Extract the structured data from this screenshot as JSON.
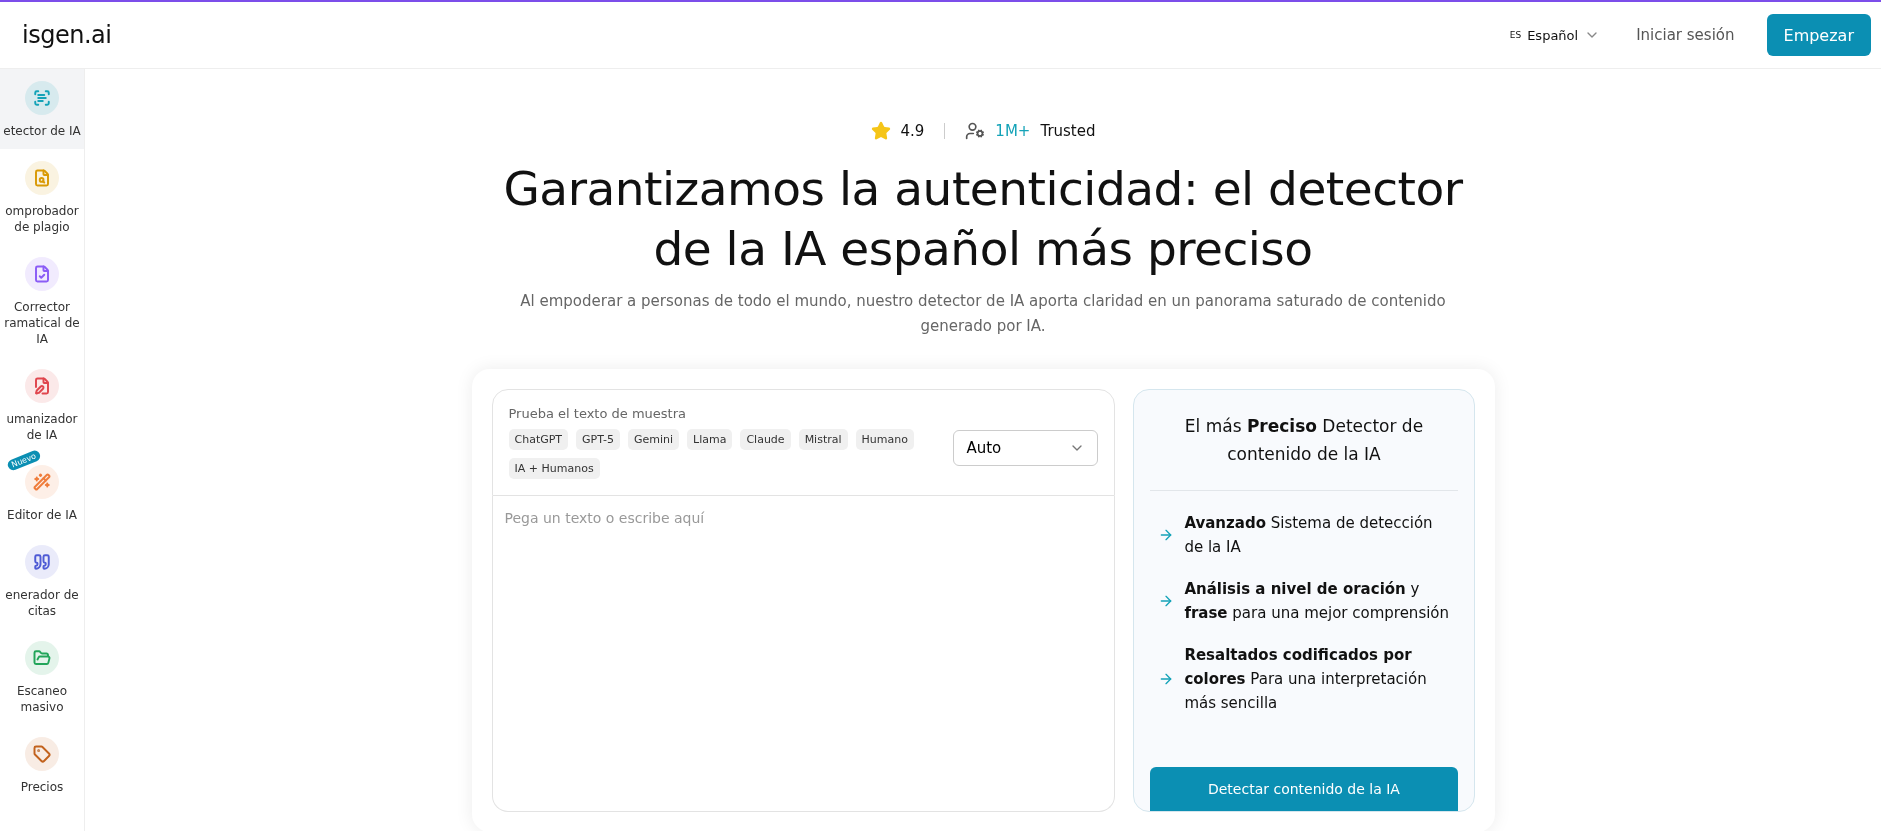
{
  "header": {
    "logo": "isgen.ai",
    "language": {
      "code": "ES",
      "label": "Español"
    },
    "login": "Iniciar sesión",
    "cta": "Empezar"
  },
  "sidebar": {
    "items": [
      {
        "label": "etector de IA",
        "selected": true,
        "color": "#14a3b8"
      },
      {
        "label": "omprobador\nde plagio",
        "selected": false,
        "color": "#d99a06"
      },
      {
        "label": "Corrector\nramatical de\nIA",
        "selected": false,
        "color": "#8b5cf6"
      },
      {
        "label": "umanizador\nde IA",
        "selected": false,
        "color": "#e0464e"
      },
      {
        "label": "Editor de IA",
        "selected": false,
        "color": "#ef7d3c",
        "badge": "Nuevo"
      },
      {
        "label": "enerador de\ncitas",
        "selected": false,
        "color": "#4f5bd5"
      },
      {
        "label": "Escaneo\nmasivo",
        "selected": false,
        "color": "#22a55a"
      },
      {
        "label": "Precios",
        "selected": false,
        "color": "#c2621d"
      }
    ]
  },
  "hero": {
    "rating": "4.9",
    "users": "1M+",
    "users_label": "Trusted",
    "title": "Garantizamos la autenticidad: el detector de la IA español más preciso",
    "subtitle": "Al empoderar a personas de todo el mundo, nuestro detector de IA aporta claridad en un panorama saturado de contenido generado por IA."
  },
  "editor": {
    "sample_label": "Prueba el texto de muestra",
    "samples": [
      "ChatGPT",
      "GPT-5",
      "Gemini",
      "Llama",
      "Claude",
      "Mistral",
      "Humano",
      "IA + Humanos"
    ],
    "model_select": "Auto",
    "placeholder": "Pega un texto o escribe aquí"
  },
  "info_panel": {
    "title": "El más **Preciso** Detector de contenido de la IA",
    "features": [
      "**Avanzado** Sistema de detección de la IA",
      "**Análisis a nivel de oración** y **frase** para una mejor comprensión",
      "**Resaltados codificados por colores** Para una interpretación más sencilla"
    ],
    "button": "Detectar contenido de la IA"
  }
}
